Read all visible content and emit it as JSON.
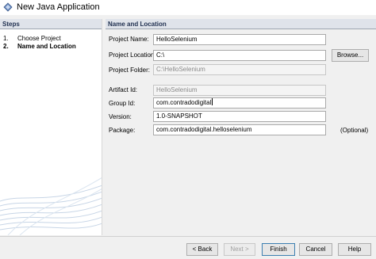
{
  "window": {
    "title": "New Java Application"
  },
  "steps": {
    "header": "Steps",
    "items": [
      {
        "num": "1.",
        "label": "Choose Project"
      },
      {
        "num": "2.",
        "label": "Name and Location"
      }
    ]
  },
  "panel": {
    "header": "Name and Location",
    "fields": {
      "project_name": {
        "label": "Project Name:",
        "value": "HelloSelenium"
      },
      "project_location": {
        "label": "Project Location:",
        "value": "C:\\"
      },
      "project_folder": {
        "label": "Project Folder:",
        "value": "C:\\HelloSelenium"
      },
      "artifact_id": {
        "label": "Artifact Id:",
        "value": "HelloSelenium"
      },
      "group_id": {
        "label": "Group Id:",
        "value": "com.contradodigital"
      },
      "version": {
        "label": "Version:",
        "value": "1.0-SNAPSHOT"
      },
      "package": {
        "label": "Package:",
        "value": "com.contradodigital.helloselenium",
        "note": "(Optional)"
      }
    },
    "browse_label": "Browse..."
  },
  "buttons": {
    "back": "< Back",
    "next": "Next >",
    "finish": "Finish",
    "cancel": "Cancel",
    "help": "Help"
  },
  "colors": {
    "header_bg": "#dfe3ea",
    "accent": "#3c7fb1"
  },
  "icons": {
    "app": "java-cup-icon"
  }
}
